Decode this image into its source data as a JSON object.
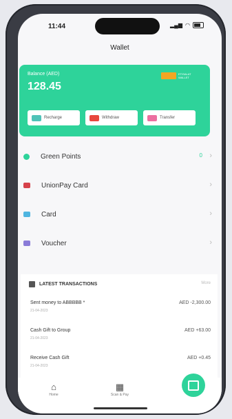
{
  "status": {
    "time": "11:44"
  },
  "header": {
    "title": "Wallet"
  },
  "balance": {
    "label": "Balance (AED)",
    "amount": "128.45",
    "logo_text": "ETISALAT WALLET"
  },
  "actions": [
    {
      "label": "Recharge",
      "icon": "recharge-icon",
      "color": "#4fc3b8"
    },
    {
      "label": "Withdraw",
      "icon": "withdraw-icon",
      "color": "#e8473d"
    },
    {
      "label": "Transfer",
      "icon": "transfer-icon",
      "color": "#ec6fa0"
    }
  ],
  "menu": [
    {
      "label": "Green Points",
      "icon": "leaf-icon",
      "color": "#2ed39a",
      "value": "0"
    },
    {
      "label": "UnionPay Card",
      "icon": "unionpay-card-icon",
      "color": "#d6424b"
    },
    {
      "label": "Card",
      "icon": "card-icon",
      "color": "#4fb5e0"
    },
    {
      "label": "Voucher",
      "icon": "voucher-icon",
      "color": "#8a7bd8"
    }
  ],
  "transactions": {
    "title": "LATEST TRANSACTIONS",
    "more": "More",
    "items": [
      {
        "name": "Sent money to ABBBBB *",
        "date": "21-04-2023",
        "amount": "AED -2,300.00"
      },
      {
        "name": "Cash Gift to Group",
        "date": "21-04-2023",
        "amount": "AED +63.00"
      },
      {
        "name": "Receive Cash Gift",
        "date": "21-04-2023",
        "amount": "AED +0.45"
      }
    ]
  },
  "tabbar": {
    "home": "Home",
    "scan": "Scan & Pay"
  },
  "colors": {
    "accent": "#2ed39a"
  }
}
